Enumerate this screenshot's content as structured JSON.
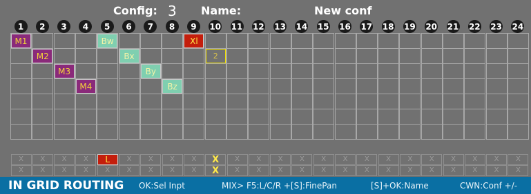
{
  "header": {
    "config_label": "Config:",
    "config_value": "3",
    "name_label": "Name:",
    "name_value": "New conf"
  },
  "columns": [
    "1",
    "2",
    "3",
    "4",
    "5",
    "6",
    "7",
    "8",
    "9",
    "10",
    "11",
    "12",
    "13",
    "14",
    "15",
    "16",
    "17",
    "18",
    "19",
    "20",
    "21",
    "22",
    "23",
    "24"
  ],
  "grid": {
    "rows": 7
  },
  "routes": [
    {
      "label": "M1",
      "col": 1,
      "row": 1,
      "kind": "m"
    },
    {
      "label": "M2",
      "col": 2,
      "row": 2,
      "kind": "m"
    },
    {
      "label": "M3",
      "col": 3,
      "row": 3,
      "kind": "m"
    },
    {
      "label": "M4",
      "col": 4,
      "row": 4,
      "kind": "m"
    },
    {
      "label": "Bw",
      "col": 5,
      "row": 1,
      "kind": "b"
    },
    {
      "label": "Bx",
      "col": 6,
      "row": 2,
      "kind": "b"
    },
    {
      "label": "By",
      "col": 7,
      "row": 3,
      "kind": "b"
    },
    {
      "label": "Bz",
      "col": 8,
      "row": 4,
      "kind": "b"
    },
    {
      "label": "Xl",
      "col": 9,
      "row": 1,
      "kind": "xl"
    },
    {
      "label": "2",
      "col": 10,
      "row": 2,
      "kind": "selected"
    }
  ],
  "input_rows": {
    "empty_label": "X",
    "row1_overrides": [
      {
        "col": 5,
        "label": "L",
        "kind": "l"
      },
      {
        "col": 10,
        "label": "X",
        "kind": "x"
      }
    ],
    "row2_overrides": [
      {
        "col": 10,
        "label": "X",
        "kind": "x"
      }
    ]
  },
  "statusbar": {
    "title": "IN GRID ROUTING",
    "hint1": "OK:Sel Inpt",
    "hint2": "MIX> F5:L/C/R +[S]:FinePan",
    "hint3": "[S]+OK:Name",
    "hint4": "CWN:Conf +/-"
  },
  "colors": {
    "background": "#717171",
    "statusbar": "#0a6fa3",
    "accent_yellow": "#ffe94a",
    "m_tag": "#8a2a7a",
    "b_tag": "#7fcfb0",
    "red_tag": "#c41e0c"
  }
}
